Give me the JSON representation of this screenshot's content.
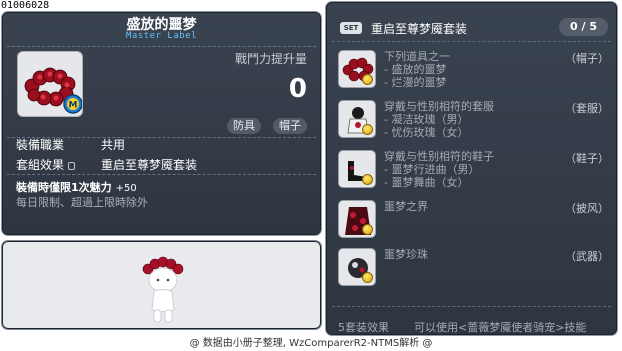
{
  "item_id": "01006028",
  "tooltip": {
    "name": "盛放的噩梦",
    "master_label": "Master Label",
    "power_label": "戰鬥力提升量",
    "power_value": "0",
    "tags": [
      "防具",
      "帽子"
    ],
    "job_label": "裝備職業",
    "job_value": "共用",
    "set_label": "套組效果",
    "set_value": "重启至尊梦魇套装",
    "bonus_label": "裝備時僅限1次魅力",
    "bonus_value": "+50",
    "limit_text": "每日限制、超過上限時除外",
    "icon": "rose-wreath-hat-icon"
  },
  "set_panel": {
    "badge": "SET",
    "title": "重启至尊梦魇套装",
    "count": "0 / 5",
    "items": [
      {
        "icon": "rose-wreath-hat-icon",
        "lines": [
          "下列道具之一",
          "- 盛放的噩梦",
          "- 烂漫的噩梦"
        ],
        "category": "（帽子）"
      },
      {
        "icon": "suit-outfit-icon",
        "lines": [
          "穿戴与性别相符的套服",
          "- 凝洁玫瑰（男）",
          "- 忧伤玫瑰（女）"
        ],
        "category": "（套服）"
      },
      {
        "icon": "shoes-icon",
        "lines": [
          "穿戴与性别相符的鞋子",
          "- 噩梦行进曲（男）",
          "- 噩梦舞曲（女）"
        ],
        "category": "（鞋子）"
      },
      {
        "icon": "cape-icon",
        "lines": [
          "噩梦之界"
        ],
        "category": "（披风）"
      },
      {
        "icon": "orb-weapon-icon",
        "lines": [
          "噩梦珍珠"
        ],
        "category": "（武器）"
      }
    ],
    "footer_label": "5套装效果",
    "footer_desc": "可以使用<蔷薇梦魇使者骑宠>技能"
  },
  "credit": "@ 数据由小册子整理, WzComparerR2-NTMS解析 @"
}
